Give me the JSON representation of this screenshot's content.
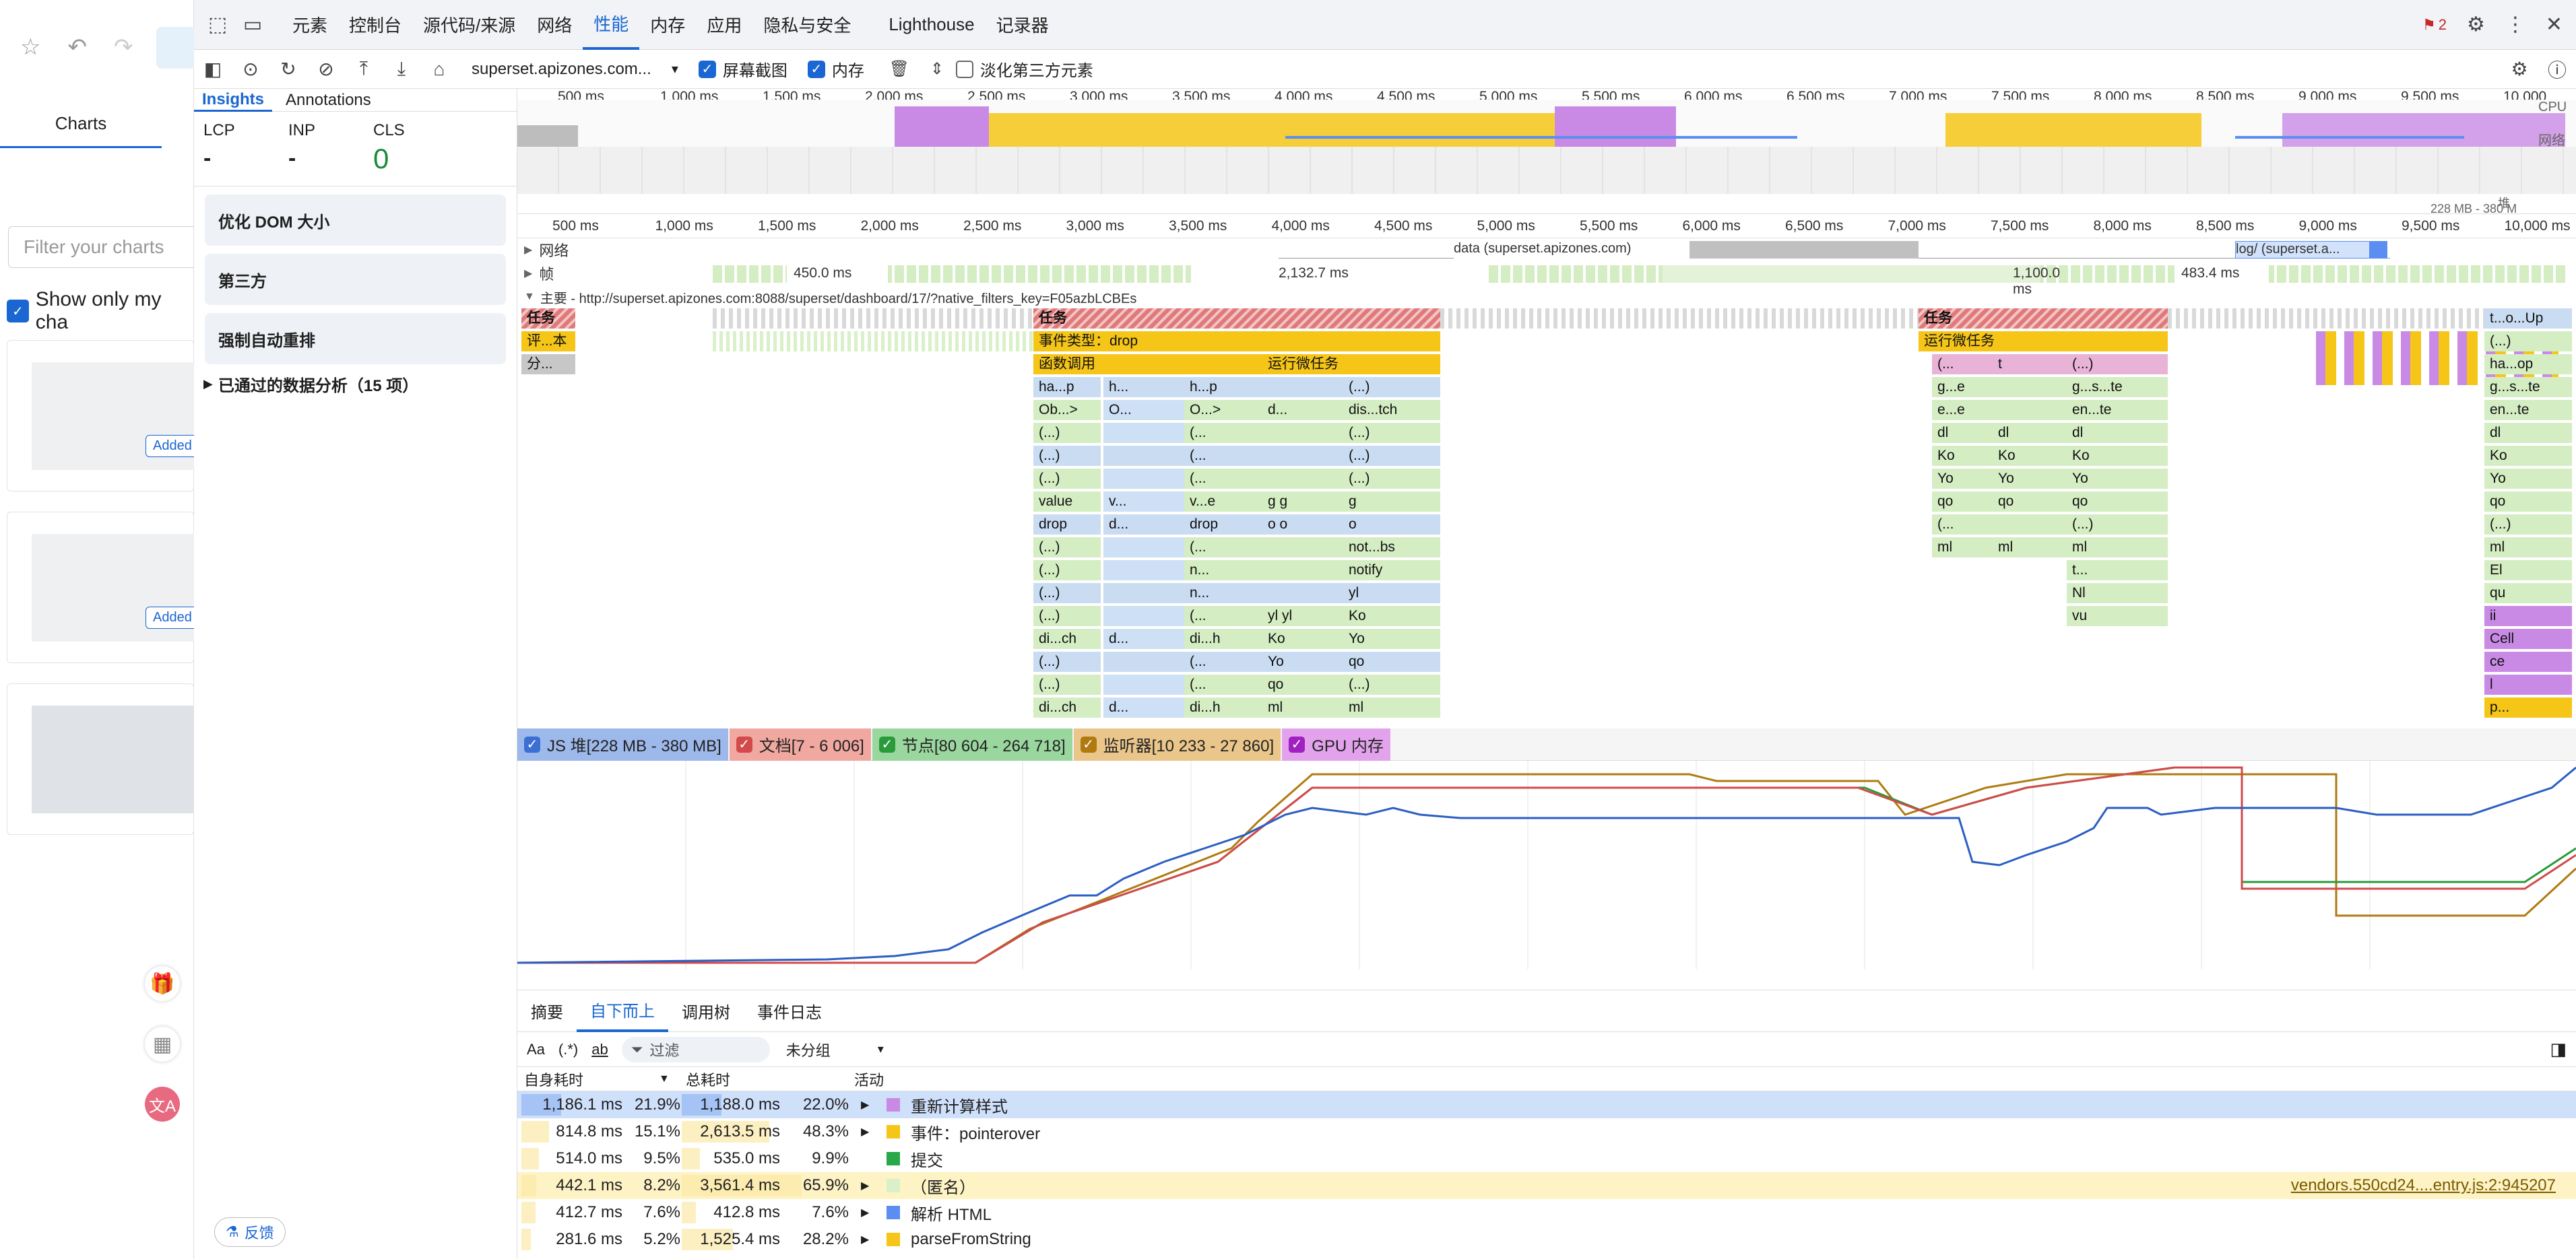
{
  "left_app": {
    "nav_label": "Charts",
    "filter_placeholder": "Filter your charts",
    "show_only_label": "Show only my cha",
    "added_badge": "Added"
  },
  "devtools": {
    "tabs": [
      "元素",
      "控制台",
      "源代码/来源",
      "网络",
      "性能",
      "内存",
      "应用",
      "隐私与安全",
      "Lighthouse",
      "记录器"
    ],
    "active_tab": "性能",
    "issues_count": "2",
    "toolbar": {
      "url": "superset.apizones.com...",
      "screenshot_label": "屏幕截图",
      "memory_label": "内存",
      "dim_third_party_label": "淡化第三方元素"
    },
    "insights": {
      "tabs": [
        "Insights",
        "Annotations"
      ],
      "metrics": [
        {
          "name": "LCP",
          "value": "-"
        },
        {
          "name": "INP",
          "value": "-"
        },
        {
          "name": "CLS",
          "value": "0"
        }
      ],
      "cards": [
        "优化 DOM 大小",
        "第三方",
        "强制自动重排"
      ],
      "passed": "已通过的数据分析（15 项）",
      "feedback": "反馈"
    },
    "overview_ticks": [
      "500 ms",
      "1,000 ms",
      "1,500 ms",
      "2,000 ms",
      "2,500 ms",
      "3,000 ms",
      "3,500 ms",
      "4,000 ms",
      "4,500 ms",
      "5,000 ms",
      "5,500 ms",
      "6,000 ms",
      "6,500 ms",
      "7,000 ms",
      "7,500 ms",
      "8,000 ms",
      "8,500 ms",
      "9,000 ms",
      "9,500 ms",
      "10,000"
    ],
    "overview_labels": {
      "cpu": "CPU",
      "net": "网络",
      "heap": "堆",
      "heap_range": "228 MB - 380 M"
    },
    "ruler_ticks": [
      "500 ms",
      "1,000 ms",
      "1,500 ms",
      "2,000 ms",
      "2,500 ms",
      "3,000 ms",
      "3,500 ms",
      "4,000 ms",
      "4,500 ms",
      "5,000 ms",
      "5,500 ms",
      "6,000 ms",
      "6,500 ms",
      "7,000 ms",
      "7,500 ms",
      "8,000 ms",
      "8,500 ms",
      "9,000 ms",
      "9,500 ms",
      "10,000 ms"
    ],
    "tracks": {
      "network": "网络",
      "network_req1": "data (superset.apizones.com)",
      "network_req2": "log/ (superset.a...",
      "frames": "帧",
      "frame_times": [
        "450.0 ms",
        "2,132.7 ms",
        "1,100.0 ms",
        "483.4 ms"
      ],
      "main": "主要 - http://superset.apizones.com:8088/superset/dashboard/17/?native_filters_key=F05azbLCBEs"
    },
    "flame": {
      "task": "任务",
      "eval": "评...本",
      "parse": "分...",
      "event_drop": "事件类型：drop",
      "func_call": "函数调用",
      "microtask": "运行微任务",
      "run_microtask_right": "运行微任务",
      "col1": [
        "ha...p",
        "Ob...>",
        "(...)",
        "(...)",
        "(...)",
        "value",
        "drop",
        "(...)",
        "(...)",
        "(...)",
        "(...)",
        "di...ch",
        "(...)",
        "(...)",
        "di...ch"
      ],
      "col2": [
        "h...",
        "O...",
        "",
        "",
        "",
        "v...",
        "d...",
        "",
        "",
        "",
        "",
        "d...",
        "",
        "",
        "d..."
      ],
      "col3": [
        "h...p",
        "O...>",
        "(...",
        "(...",
        "(...",
        "v...e",
        "drop",
        "(...",
        "n...",
        "n...",
        "(...",
        "di...h",
        "(...",
        "(...",
        "di...h"
      ],
      "col4": [
        "",
        "d...",
        "",
        "",
        "",
        "g    g",
        "o    o",
        "",
        "",
        "",
        "yl    yl",
        "Ko",
        "Yo",
        "qo",
        "ml"
      ],
      "col5": [
        "(...)",
        "dis...tch",
        "(...)",
        "(...)",
        "(...)",
        "g",
        "o",
        "not...bs",
        "notify",
        "yl",
        "Ko",
        "Yo",
        "qo",
        "(...)",
        "ml"
      ],
      "r1": [
        "(...",
        "g...e",
        "e...e",
        "dl",
        "Ko",
        "Yo",
        "qo",
        "(...",
        "ml"
      ],
      "r2": [
        "t",
        "",
        "",
        "dl",
        "Ko",
        "Yo",
        "qo",
        "",
        "ml"
      ],
      "r3": [
        "(...)",
        "g...s...te",
        "en...te",
        "dl",
        "Ko",
        "Yo",
        "qo",
        "(...)",
        "ml",
        "t...",
        "Nl",
        "vu"
      ],
      "far": [
        "t...o...Up",
        "(...)",
        "ha...op",
        "g...s...te",
        "en...te",
        "dl",
        "Ko",
        "Yo",
        "qo",
        "(...)",
        "ml",
        "El",
        "qu",
        "ii",
        "Cell",
        "ce",
        "l",
        "p..."
      ]
    },
    "counters": [
      {
        "label": "JS 堆[228 MB - 380 MB]",
        "color": "#3b6fd4",
        "bg": "#9db8ea"
      },
      {
        "label": "文档[7 - 6 006]",
        "color": "#d24a4a",
        "bg": "#f0a8a0"
      },
      {
        "label": "节点[80 604 - 264 718]",
        "color": "#2a9b3b",
        "bg": "#9ad79e"
      },
      {
        "label": "监听器[10 233 - 27 860]",
        "color": "#b07a10",
        "bg": "#eac68b"
      },
      {
        "label": "GPU 内存",
        "color": "#a020c0",
        "bg": "#e2a2ec"
      }
    ],
    "bottom": {
      "tabs": [
        "摘要",
        "自下而上",
        "调用树",
        "事件日志"
      ],
      "active_tab": "自下而上",
      "filter_placeholder": "过滤",
      "group_label": "未分组",
      "headers": {
        "self": "自身耗时",
        "total": "总耗时",
        "activity": "活动"
      },
      "rows": [
        {
          "self": "1,186.1 ms",
          "self_pct": "21.9%",
          "total": "1,188.0 ms",
          "total_pct": "22.0%",
          "activity": "重新计算样式",
          "color": "#c98ae6",
          "source": ""
        },
        {
          "self": "814.8 ms",
          "self_pct": "15.1%",
          "total": "2,613.5 ms",
          "total_pct": "48.3%",
          "activity": "事件：pointerover",
          "color": "#f5c518",
          "source": ""
        },
        {
          "self": "514.0 ms",
          "self_pct": "9.5%",
          "total": "535.0 ms",
          "total_pct": "9.9%",
          "activity": "提交",
          "color": "#29a84a",
          "source": ""
        },
        {
          "self": "442.1 ms",
          "self_pct": "8.2%",
          "total": "3,561.4 ms",
          "total_pct": "65.9%",
          "activity": "（匿名）",
          "color": "#d9f0c8",
          "source": "vendors.550cd24....entry.js:2:945207"
        },
        {
          "self": "412.7 ms",
          "self_pct": "7.6%",
          "total": "412.8 ms",
          "total_pct": "7.6%",
          "activity": "解析 HTML",
          "color": "#5b8ef0",
          "source": ""
        },
        {
          "self": "281.6 ms",
          "self_pct": "5.2%",
          "total": "1,525.4 ms",
          "total_pct": "28.2%",
          "activity": "parseFromString",
          "color": "#f5c518",
          "source": ""
        }
      ]
    }
  }
}
